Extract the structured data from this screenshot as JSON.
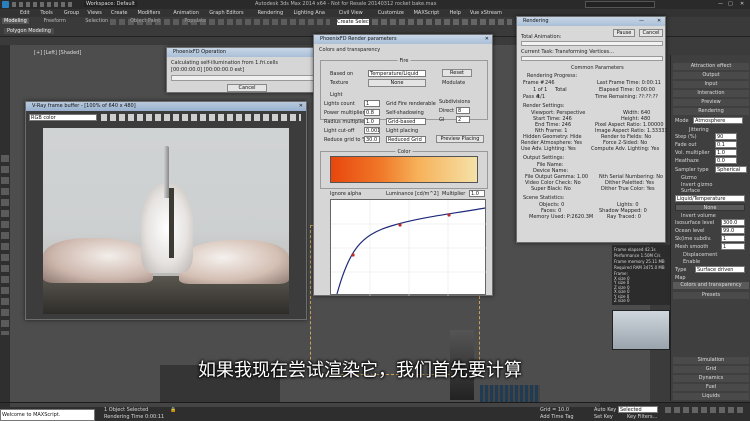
{
  "titlebar": {
    "workspace": "Workspace: Default",
    "file_title": "Autodesk 3ds Max 2014 x64 - Not for Resale  20140312 rocket bake.max"
  },
  "menubar": {
    "items": [
      "Edit",
      "Tools",
      "Group",
      "Views",
      "Create",
      "Modifiers",
      "Animation",
      "Graph Editors",
      "Rendering",
      "Lighting Ana",
      "Civil View",
      "Customize",
      "MAXScript",
      "Help",
      "Vue xStream"
    ]
  },
  "ribbon": {
    "tabs": [
      "Modeling",
      "Freeform",
      "Selection",
      "Object Paint",
      "Populate"
    ],
    "subtab": "Polygon Modeling",
    "selection_set": "Create Selection Se"
  },
  "viewport": {
    "label": "[+] [Left] [Shaded]"
  },
  "phoenix_op": {
    "title": "PhoenixFD Operation",
    "message": "Calculating self-illumination from 1.fri.cells",
    "time": "[00:00:00.0] [00:00:00.0 est]",
    "cancel": "Cancel"
  },
  "vfb": {
    "title": "V-Ray frame buffer - [100% of 640 x 480]",
    "channel": "RGB color"
  },
  "render_params": {
    "title": "PhoenixFD Render parameters",
    "tab": "Colors and transparency",
    "fire": "Fire",
    "based_on_label": "Based on",
    "based_on_value": "Temperature/Liquid",
    "reset": "Reset",
    "texture_label": "Texture",
    "texture_value": "None",
    "modulate": "Modulate",
    "light": "Light",
    "lights_count": "Lights count",
    "lights_count_val": "1",
    "grid_fire": "Grid Fire renderable",
    "subdivisions": "Subdivisions",
    "power_mult": "Power multiplier",
    "power_mult_val": "0.8",
    "direct": "Direct",
    "direct_val": "8",
    "self_shadowing": "Self-shadowing",
    "radius_mult": "Radius multiplier",
    "radius_mult_val": "1.0",
    "grid_based": "Grid-based",
    "gi": "GI",
    "gi_val": "2",
    "light_cutoff": "Light cut-off",
    "light_cutoff_val": "0.001",
    "light_placing": "Light placing",
    "reduce_grid": "Reduce grid to %",
    "reduce_grid_val": "30.0",
    "reduced_grid": "Reduced Grid",
    "preview_placing": "Preview Placing",
    "color_label": "Color",
    "ignore_alpha": "Ignore alpha",
    "luminance": "Luminance [cd/m^2]",
    "multiplier": "Multiplier",
    "multiplier_val": "1.0"
  },
  "rendering": {
    "title": "Rendering",
    "total_animation": "Total Animation:",
    "pause": "Pause",
    "cancel": "Cancel",
    "current_task_label": "Current Task:",
    "current_task": "Transforming Vertices...",
    "common_params": "Common Parameters",
    "progress_label": "Rendering Progress:",
    "frame_label": "Frame #",
    "frame_val": "246",
    "of_label": "1 of 1",
    "total": "Total",
    "pass_label": "Pass #",
    "pass_val": "1/1",
    "last_frame_time": "Last Frame Time: 0:00:11",
    "elapsed_time": "Elapsed Time: 0:00:00",
    "time_remaining": "Time Remaining: ??:??:??",
    "render_settings": "Render Settings:",
    "viewport": "Viewport: Perspective",
    "width": "Width: 640",
    "start_time": "Start Time: 246",
    "height": "Height: 480",
    "end_time": "End Time: 246",
    "pixel_aspect": "Pixel Aspect Ratio: 1.00000",
    "nth_frame": "Nth Frame: 1",
    "image_aspect": "Image Aspect Ratio: 1.33333",
    "hidden_geo": "Hidden Geometry: Hide",
    "render_fields": "Render to Fields: No",
    "render_atmo": "Render Atmosphere: Yes",
    "force_2sided": "Force 2-Sided: No",
    "use_adv_light": "Use Adv. Lighting: Yes",
    "compute_adv": "Compute Adv. Lighting: Yes",
    "output_settings": "Output Settings:",
    "file_name": "File Name:",
    "device_name": "Device Name:",
    "file_gamma": "File Output Gamma: 1.00",
    "nth_serial": "Nth Serial Numbering: No",
    "video_color": "Video Color Check: No",
    "dither_paletted": "Dither Paletted: Yes",
    "super_black": "Super Black: No",
    "dither_true": "Dither True Color: Yes",
    "scene_stats": "Scene Statistics:",
    "objects": "Objects: 0",
    "lights": "Lights: 0",
    "faces": "Faces: 0",
    "shadow_mapped": "Shadow Mapped: 0",
    "memory": "Memory Used: P:2620.3M",
    "ray_traced": "Ray Traced: 0"
  },
  "cmdpanel": {
    "attraction": "Attraction effect",
    "output": "Output",
    "input": "Input",
    "interaction": "Interaction",
    "preview": "Preview",
    "rendering": "Rendering",
    "mode_label": "Mode",
    "mode_val": "Atmosphere",
    "jittering": "Jittering",
    "step": "Step (%)",
    "step_val": "90",
    "fade_out": "Fade out",
    "fade_out_val": "0.1",
    "vol_mult": "Vol. multiplier",
    "vol_mult_val": "1.0",
    "heathaze": "Heathaze",
    "heathaze_val": "0.0",
    "sampler": "Sampler type",
    "sampler_val": "Spherical",
    "gizmo": "Gizmo",
    "invert_gizmo": "Invert gizmo",
    "surface": "Surface",
    "surface_val": "Liquid/Temperature",
    "none": "None",
    "invert_volume": "Invert volume",
    "isosurface_level": "Isosurface level",
    "isosurface_val": "300.0",
    "ocean_level": "Ocean level",
    "ocean_val": "99.0",
    "skin_subdiv": "Sk(ime subdiv.",
    "skin_subdiv_val": "1",
    "mesh_smooth": "Mesh smooth",
    "mesh_smooth_val": "1",
    "displacement": "Displacement",
    "enable": "Enable",
    "type_label": "Type",
    "type_val": "Surface driven",
    "map": "Map",
    "colors_transp": "Colors and transparency",
    "presets": "Presets",
    "simulation": "Simulation",
    "grid": "Grid",
    "dynamics": "Dynamics",
    "fuel": "Fuel",
    "liquids": "Liquids"
  },
  "overlay_stats": {
    "frame_elapsed": "Frame elapsed 42.1s",
    "performance": "Performance 1.50M C/s",
    "frame_mem": "Frame memory 25.11 MB",
    "used_ram": "Required RAM 3475.0 MB",
    "frame": "Frame:",
    "sizes": [
      "0",
      "0",
      "0",
      "0",
      "0",
      "0"
    ],
    "size_labels": [
      "X size",
      "Y size",
      "Z size",
      "X size",
      "Y size",
      "Z size"
    ]
  },
  "subtitle": "如果我现在尝试渲染它，我们首先要计算",
  "statusbar": {
    "welcome": "Welcome to MAXScript.",
    "selected": "1 Object Selected",
    "rendering_time": "Rendering Time 0:00:11",
    "grid": "Grid = 10.0",
    "add_time_tag": "Add Time Tag",
    "auto_key": "Auto Key",
    "selected_dd": "Selected",
    "set_key": "Set Key",
    "key_filters": "Key Filters..."
  },
  "colors": {
    "accent": "#3b6fb6",
    "fire_start": "#e8460c",
    "fire_end": "#f5e2a8",
    "curve": "#1f2a78",
    "point": "#c02a2a"
  }
}
